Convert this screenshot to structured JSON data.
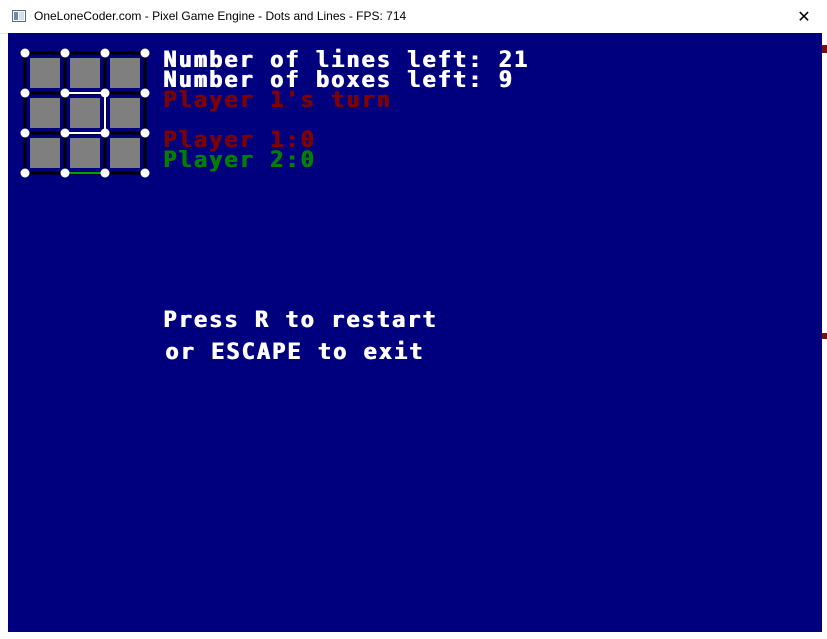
{
  "window": {
    "title": "OneLoneCoder.com - Pixel Game Engine - Dots and Lines - FPS: 714",
    "close_label": "✕"
  },
  "colors": {
    "background": "#00007f",
    "box_fill": "#7f7f7f",
    "grid_line": "#000000",
    "dot": "#ffffff",
    "player1": "#7f0000",
    "player2": "#007f00",
    "text": "#ffffff",
    "drawn_line_white": "#ffffff",
    "drawn_line_green": "#00a000"
  },
  "board": {
    "rows": 3,
    "cols": 3,
    "drawn_lines": [
      {
        "from": [
          1,
          1
        ],
        "to": [
          2,
          1
        ],
        "color": "white"
      },
      {
        "from": [
          2,
          1
        ],
        "to": [
          2,
          2
        ],
        "color": "white"
      },
      {
        "from": [
          1,
          2
        ],
        "to": [
          2,
          2
        ],
        "color": "white"
      },
      {
        "from": [
          1,
          3
        ],
        "to": [
          2,
          3
        ],
        "color": "green"
      }
    ]
  },
  "status": {
    "lines_left": "Number of lines left: 21",
    "boxes_left": "Number of boxes left: 9",
    "turn": "Player 1's turn",
    "score_p1": "Player 1:0",
    "score_p2": "Player 2:0"
  },
  "instructions": {
    "line1": "Press R to restart",
    "line2": "or ESCAPE to exit"
  }
}
